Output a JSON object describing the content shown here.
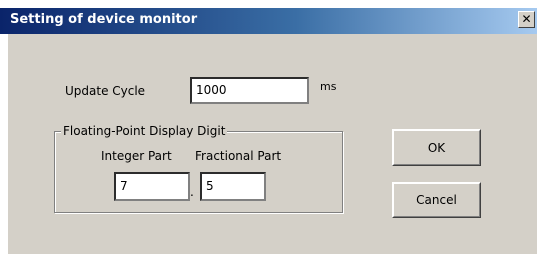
{
  "window": {
    "title": "Setting of device monitor",
    "close_glyph": "✕"
  },
  "update_cycle": {
    "label": "Update Cycle",
    "value": "1000",
    "unit": "ms"
  },
  "float_digits": {
    "group_label": "Floating-Point Display Digit",
    "integer_label": "Integer Part",
    "fraction_label": "Fractional Part",
    "integer_value": "7",
    "separator": ".",
    "fraction_value": "5"
  },
  "buttons": {
    "ok": "OK",
    "cancel": "Cancel"
  }
}
